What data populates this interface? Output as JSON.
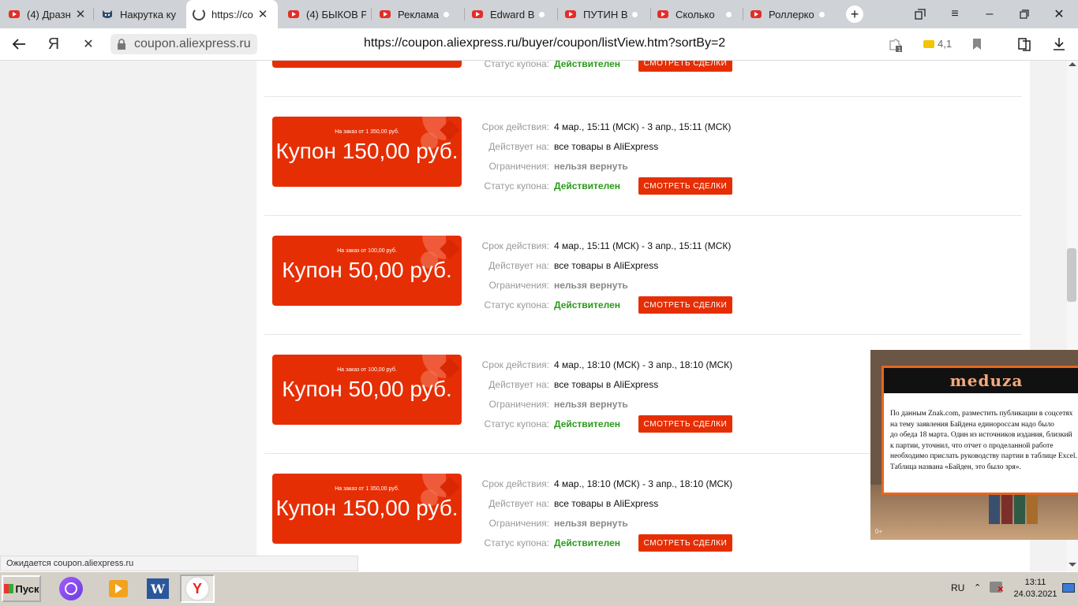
{
  "tabs": [
    {
      "title": "(4) Дразн",
      "icon": "youtube-icon",
      "closable": true
    },
    {
      "title": "Накрутка ку",
      "icon": "cat-icon"
    },
    {
      "title": "https://co",
      "icon": "loading-spinner-icon",
      "active": true,
      "closable": true
    },
    {
      "title": "(4) БЫКОВ Р",
      "icon": "youtube-icon"
    },
    {
      "title": "Реклама",
      "icon": "youtube-icon",
      "playing": true
    },
    {
      "title": "Edward B",
      "icon": "youtube-icon",
      "playing": true
    },
    {
      "title": "ПУТИН В",
      "icon": "youtube-icon",
      "playing": true
    },
    {
      "title": "Сколько",
      "icon": "youtube-icon",
      "playing": true
    },
    {
      "title": "Роллерко",
      "icon": "youtube-icon",
      "playing": true
    }
  ],
  "address_bar": {
    "domain": "coupon.aliexpress.ru",
    "url": "https://coupon.aliexpress.ru/buyer/coupon/listView.htm?sortBy=2",
    "rating": "4,1",
    "yandex_letter": "Я"
  },
  "labels": {
    "validity": "Срок действия:",
    "applies": "Действует на:",
    "restrictions": "Ограничения:",
    "status": "Статус купона:",
    "deal_button": "СМОТРЕТЬ СДЕЛКИ"
  },
  "partial_row": {
    "status": "Действителен"
  },
  "coupons": [
    {
      "condition": "На заказ от 1 350,00 руб.",
      "amount": "Купон 150,00 руб.",
      "validity": "4 мар., 15:11 (МСК) - 3 апр., 15:11 (МСК)",
      "applies": "все товары в AliExpress",
      "restrictions": "нельзя вернуть",
      "status": "Действителен"
    },
    {
      "condition": "На заказ от 100,00 руб.",
      "amount": "Купон 50,00 руб.",
      "validity": "4 мар., 15:11 (МСК) - 3 апр., 15:11 (МСК)",
      "applies": "все товары в AliExpress",
      "restrictions": "нельзя вернуть",
      "status": "Действителен"
    },
    {
      "condition": "На заказ от 100,00 руб.",
      "amount": "Купон 50,00 руб.",
      "validity": "4 мар., 18:10 (МСК) - 3 апр., 18:10 (МСК)",
      "applies": "все товары в AliExpress",
      "restrictions": "нельзя вернуть",
      "status": "Действителен"
    },
    {
      "condition": "На заказ от 1 350,00 руб.",
      "amount": "Купон 150,00 руб.",
      "validity": "4 мар., 18:10 (МСК) - 3 апр., 18:10 (МСК)",
      "applies": "все товары в AliExpress",
      "restrictions": "нельзя вернуть",
      "status": "Действителен"
    }
  ],
  "status_bar": "Ожидается coupon.aliexpress.ru",
  "popup": {
    "brand": "meduza",
    "lines": [
      "По данным Znak.com, разместить публикации в соцсетях",
      "на тему заявления Байдена единороссам надо было",
      "до обеда 18 марта. Один из источников издания, близкий",
      "к партии, уточнил, что отчет о проделанной работе",
      "необходимо прислать руководству партии в таблице Excel.",
      "Таблица названа «Байден, это было зря»."
    ],
    "age": "0+"
  },
  "taskbar": {
    "start": "Пуск",
    "lang": "RU",
    "time": "13:11",
    "date": "24.03.2021"
  },
  "colors": {
    "accent": "#e62e04",
    "status_ok": "#2a9a1a"
  }
}
